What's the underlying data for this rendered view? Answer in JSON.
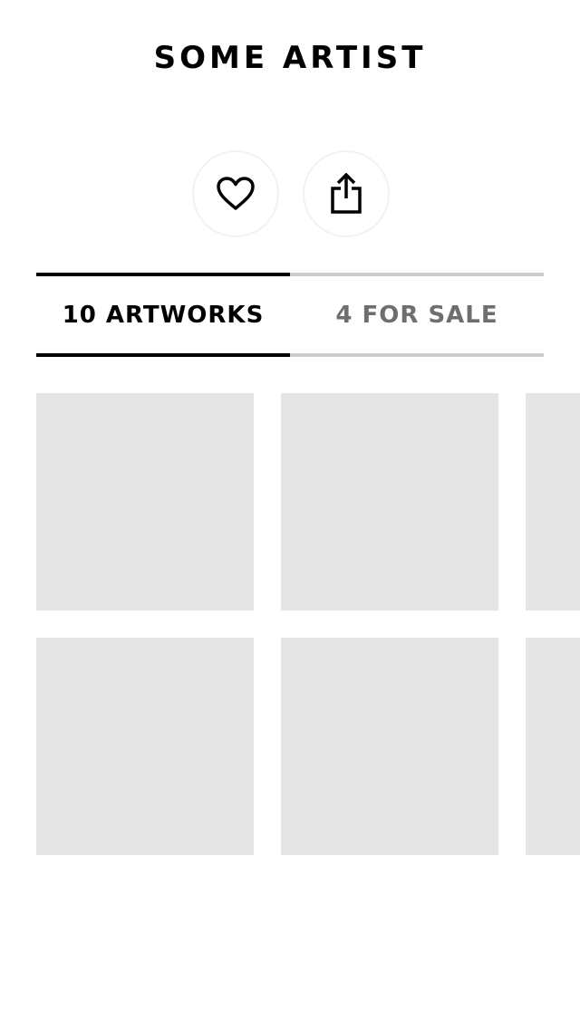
{
  "artist": {
    "name": "SOME ARTIST"
  },
  "actions": [
    {
      "icon": "heart-icon"
    },
    {
      "icon": "share-icon"
    }
  ],
  "tabs": [
    {
      "label": "10 ARTWORKS",
      "active": true
    },
    {
      "label": "4 FOR SALE",
      "active": false
    }
  ],
  "colors": {
    "tile_placeholder": "#e5e5e5",
    "active_tab": "#000000",
    "inactive_tab": "#6e6e6e",
    "inactive_border": "#cccccc"
  }
}
